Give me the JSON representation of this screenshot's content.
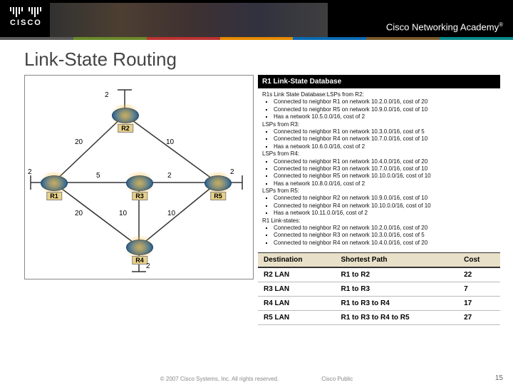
{
  "header": {
    "brand": "CISCO",
    "academy": "Cisco Networking Academy",
    "tm": "®"
  },
  "title": "Link-State Routing",
  "topology": {
    "routers": {
      "r1": "R1",
      "r2": "R2",
      "r3": "R3",
      "r4": "R4",
      "r5": "R5"
    },
    "lan_costs": {
      "r1": "2",
      "r2": "2",
      "r3_left": "5",
      "r3_right": "2",
      "r4": "2",
      "r5": "2"
    },
    "link_costs": {
      "r1_r2": "20",
      "r2_r5": "10",
      "r1_r3": "5",
      "r3_r5": "2",
      "r1_r4": "20",
      "r3_r4": "10",
      "r4_r5": "10"
    }
  },
  "database": {
    "header": "R1 Link-State Database",
    "intro": "R1s Link State Database:LSPs from R2:",
    "r2": [
      "Connected to neighbor R1 on network 10.2.0.0/16, cost of 20",
      "Connected to neighbor R5 on network 10.9.0.0/16, cost of 10",
      "Has a network 10.5.0.0/16, cost of 2"
    ],
    "r3_lbl": "LSPs from R3:",
    "r3": [
      "Connected to neighbor R1 on network 10.3.0.0/16, cost of 5",
      "Connected to neighbor R4 on network 10.7.0.0/16, cost of 10",
      "Has a network 10.6.0.0/16, cost of 2"
    ],
    "r4_lbl": "LSPs from R4:",
    "r4": [
      "Connected to neighbor R1 on network 10.4.0.0/16, cost of 20",
      "Connected to neighbor R3 on network 10.7.0.0/16, cost of 10",
      "Connected to neighbor R5 on network 10.10.0.0/16, cost of 10",
      "Has a network 10.8.0.0/16, cost of 2"
    ],
    "r5_lbl": "LSPs from R5:",
    "r5": [
      "Connected to neighbor R2 on network 10.9.0.0/16, cost of 10",
      "Connected to neighbor R4 on network 10.10.0.0/16, cost of 10",
      "Has a network 10.11.0.0/16, cost of 2"
    ],
    "r1_lbl": "R1 Link-states:",
    "r1": [
      "Connected to neighbor R2 on network 10.2.0.0/16, cost of 20",
      "Connected to neighbor R3 on network 10.3.0.0/16, cost of 5",
      "Connected to neighbor R4 on network 10.4.0.0/16, cost of 20"
    ]
  },
  "dest_table": {
    "headers": {
      "dest": "Destination",
      "path": "Shortest Path",
      "cost": "Cost"
    },
    "rows": [
      {
        "dest": "R2 LAN",
        "path": "R1 to R2",
        "cost": "22"
      },
      {
        "dest": "R3 LAN",
        "path": "R1 to R3",
        "cost": "7"
      },
      {
        "dest": "R4 LAN",
        "path": "R1 to R3 to R4",
        "cost": "17"
      },
      {
        "dest": "R5 LAN",
        "path": "R1 to R3 to R4 to R5",
        "cost": "27"
      }
    ]
  },
  "footer": {
    "copyright": "© 2007 Cisco Systems, Inc. All rights reserved.",
    "classification": "Cisco Public",
    "page": "15"
  }
}
